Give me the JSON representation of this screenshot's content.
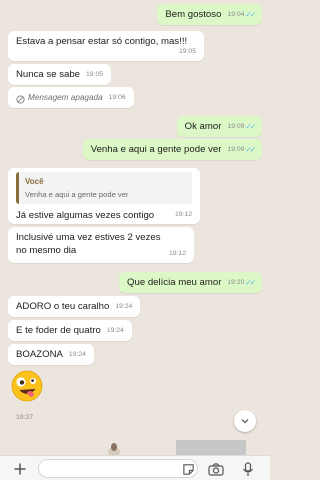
{
  "messages": [
    {
      "dir": "out",
      "text": "Bem gostoso",
      "time": "19:04",
      "read": true
    },
    {
      "dir": "in",
      "text": "Estava a pensar estar só contigo, mas!!!",
      "time": "19:05"
    },
    {
      "dir": "in",
      "text": "Nunca se sabe",
      "time": "19:05"
    },
    {
      "dir": "in",
      "text": "Mensagem apagada",
      "time": "19:06",
      "deleted": true
    },
    {
      "dir": "out",
      "text": "Ok amor",
      "time": "19:09",
      "read": true
    },
    {
      "dir": "out",
      "text": "Venha e aqui a gente pode ver",
      "time": "19:09",
      "read": true
    },
    {
      "dir": "in",
      "quote_author": "Você",
      "quote_text": "Venha e aqui a gente pode ver",
      "text": "Já estive algumas vezes contigo",
      "time": "19:12"
    },
    {
      "dir": "in",
      "text": "Inclusivé uma vez estives 2 vezes no mesmo dia",
      "time": "19:12"
    },
    {
      "dir": "out",
      "text": "Que delícia meu amor",
      "time": "19:20",
      "read": true
    },
    {
      "dir": "in",
      "text": "ADORO o teu caralho",
      "time": "19:24"
    },
    {
      "dir": "in",
      "text": "E te foder de quatro",
      "time": "19:24"
    },
    {
      "dir": "in",
      "text": "BOAZONA",
      "time": "19:24"
    },
    {
      "dir": "in",
      "emoji": "zany-face",
      "time": "19:27"
    }
  ],
  "composer": {
    "placeholder": ""
  },
  "icons": [
    "double-check-icon",
    "deleted-message-icon",
    "chevron-down-icon",
    "plus-icon",
    "sticker-icon",
    "camera-icon",
    "microphone-icon"
  ],
  "colors": {
    "incoming": "#ffffff",
    "outgoing": "#dcf8c6",
    "read_ticks": "#4fb6ec",
    "background": "#ece5dd",
    "quote_author": "#8a6d3b"
  }
}
